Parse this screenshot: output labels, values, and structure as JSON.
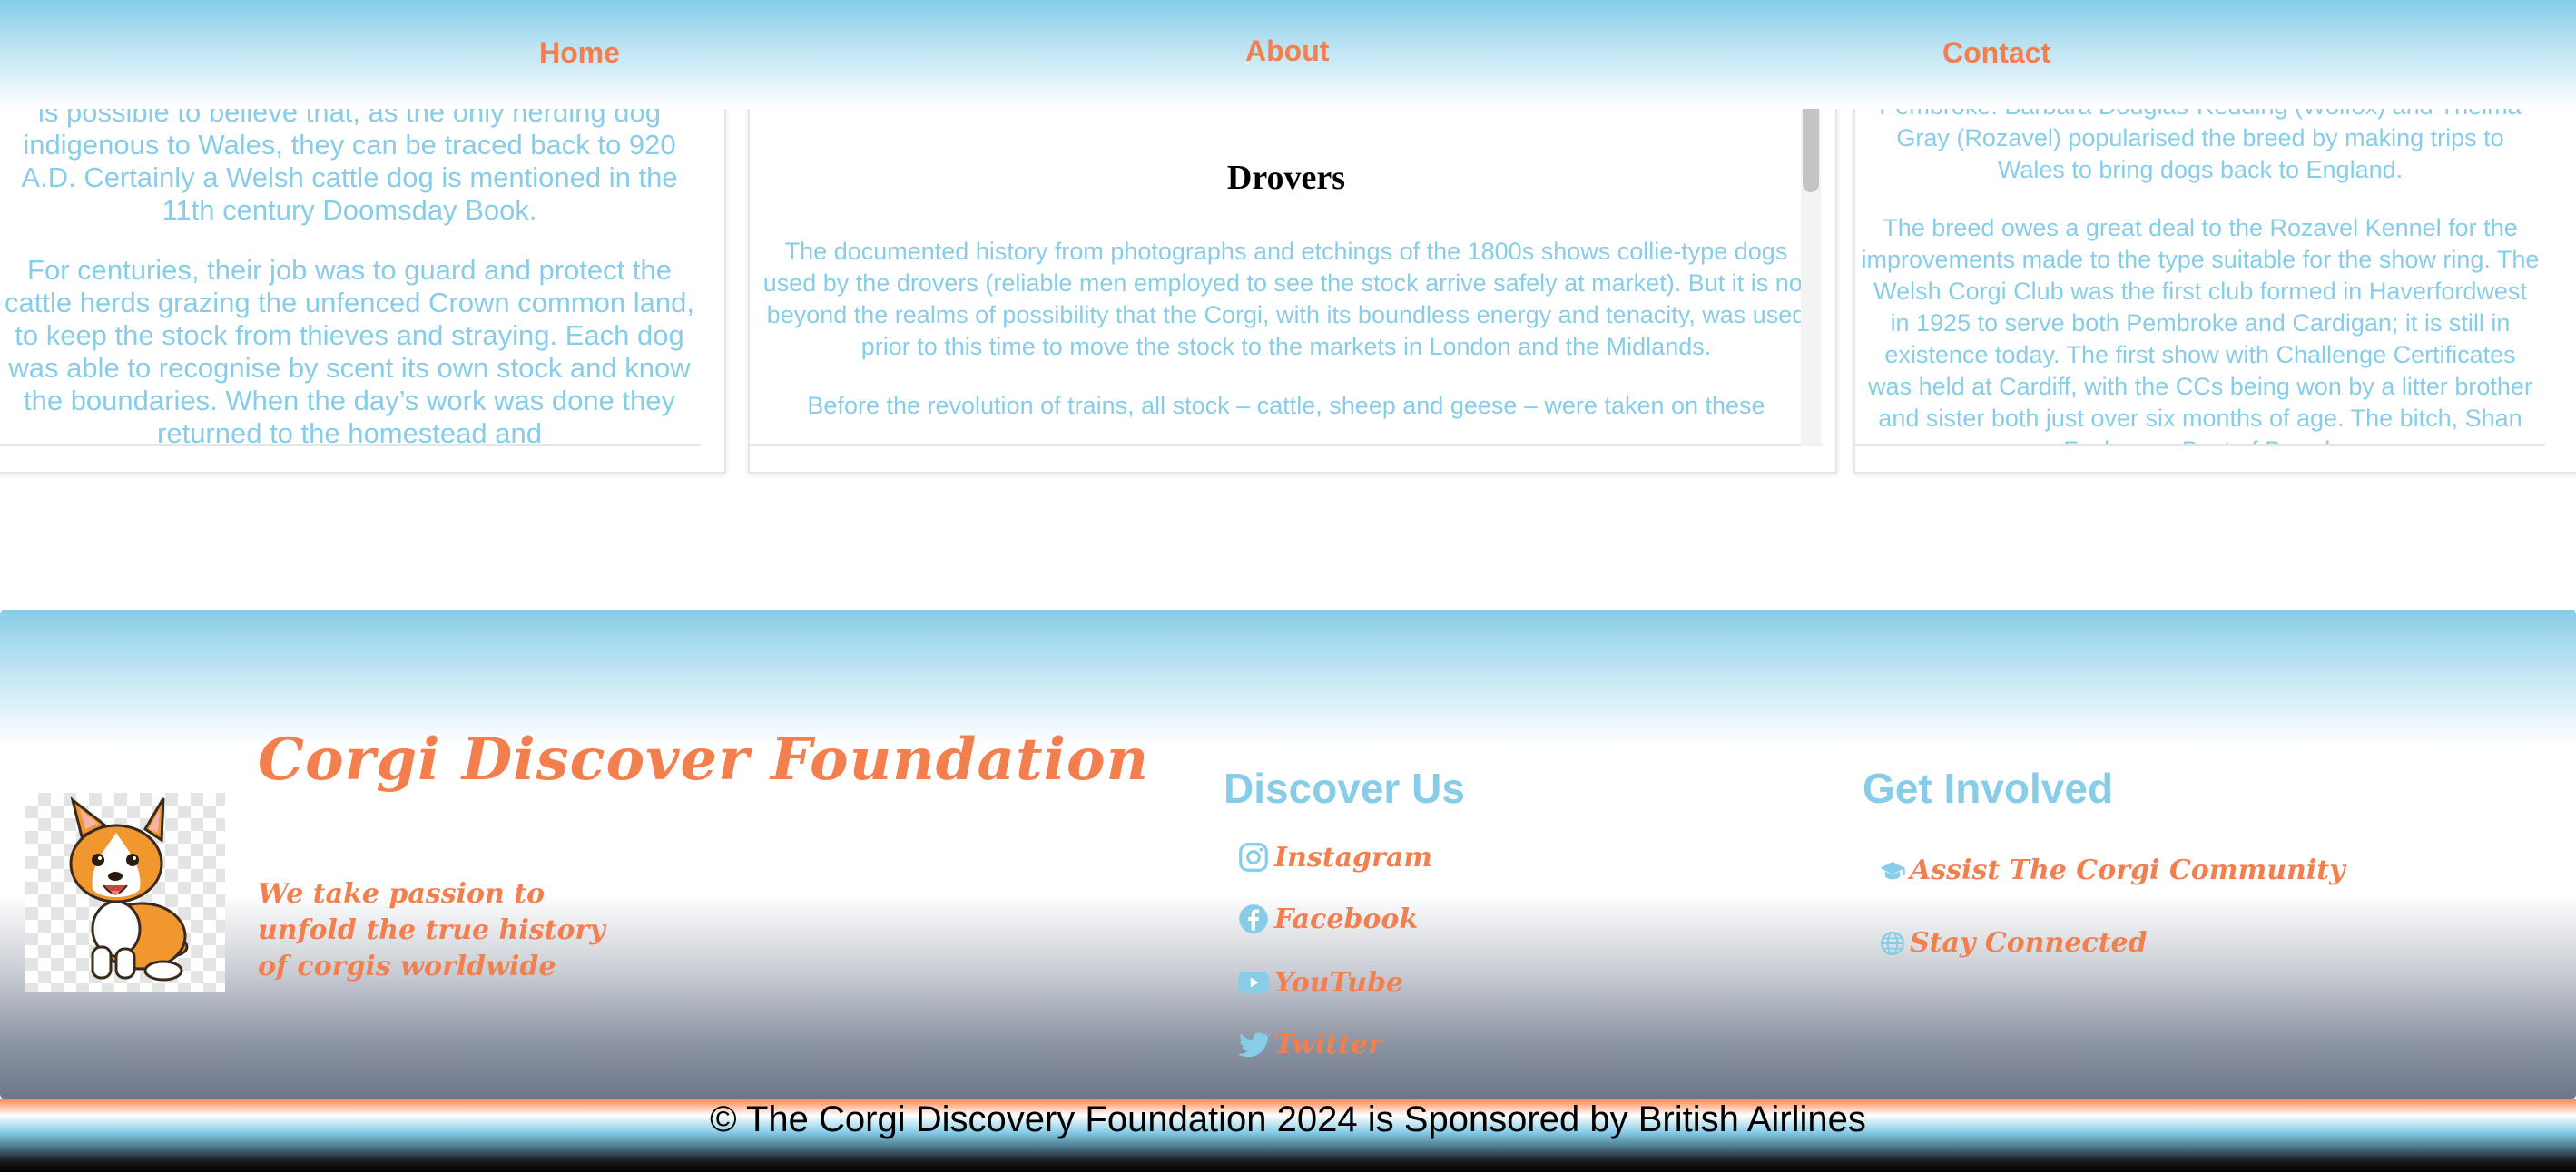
{
  "nav": {
    "home": "Home",
    "about": "About",
    "contact": "Contact"
  },
  "cards": {
    "left": {
      "paragraphs": [
        "is possible to believe that, as the only herding dog indigenous to Wales, they can be traced back to 920 A.D. Certainly a Welsh cattle dog is mentioned in the 11th century Doomsday Book.",
        "For centuries, their job was to guard and protect the cattle herds grazing the unfenced Crown common land, to keep the stock from thieves and straying. Each dog was able to recognise by scent its own stock and know the boundaries. When the day’s work was done they returned to the homestead and"
      ]
    },
    "middle": {
      "title": "Drovers",
      "paragraphs": [
        "The documented history from photographs and etchings of the 1800s shows collie-type dogs used by the drovers (reliable men employed to see the stock arrive safely at market). But it is not beyond the realms of possibility that the Corgi, with its boundless energy and tenacity, was used prior to this time to move the stock to the markets in London and the Midlands.",
        "Before the revolution of trains, all stock – cattle, sheep and geese – were taken on these"
      ]
    },
    "right": {
      "paragraphs": [
        "Pembroke. Barbara Douglas-Redding (Wolfox) and Thelma Gray (Rozavel) popularised the breed by making trips to Wales to bring dogs back to England.",
        "The breed owes a great deal to the Rozavel Kennel for the improvements made to the type suitable for the show ring. The Welsh Corgi Club was the first club formed in Haverfordwest in 1925 to serve both Pembroke and Cardigan; it is still in existence today. The first show with Challenge Certificates was held at Cardiff, with the CCs being won by a litter brother and sister both just over six months of age. The bitch, Shan Fach, was Best of Breed."
      ]
    }
  },
  "footer": {
    "brand": "Corgi Discover Foundation",
    "tagline": "We take passion to unfold the true history of corgis worldwide",
    "discover": {
      "heading": "Discover Us",
      "links": [
        {
          "label": "Instagram",
          "icon": "instagram-icon"
        },
        {
          "label": "Facebook",
          "icon": "facebook-icon"
        },
        {
          "label": "YouTube",
          "icon": "youtube-icon"
        },
        {
          "label": "Twitter",
          "icon": "twitter-icon"
        }
      ]
    },
    "involved": {
      "heading": "Get Involved",
      "links": [
        {
          "label": "Assist The Corgi Community",
          "icon": "graduation-cap-icon"
        },
        {
          "label": "Stay Connected",
          "icon": "globe-icon"
        }
      ]
    }
  },
  "copyright": "© The Corgi Discovery Foundation 2024 is Sponsored by British Airlines",
  "colors": {
    "accent_orange": "#f37f4f",
    "sky_blue": "#87cde8"
  }
}
